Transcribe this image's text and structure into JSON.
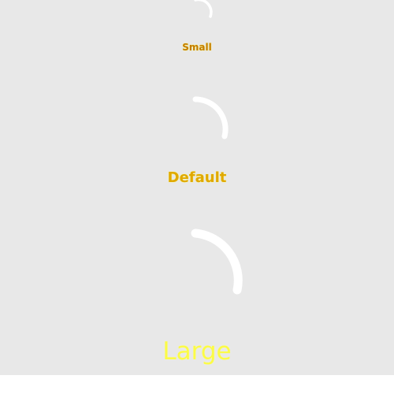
{
  "spinners": {
    "small": {
      "label": "Small"
    },
    "default": {
      "label": "Default"
    },
    "large": {
      "label": "Large"
    }
  },
  "colors": {
    "background": "#e8e8e8",
    "spinner_arc": "#ffffff",
    "label_text": "#ffff44"
  }
}
